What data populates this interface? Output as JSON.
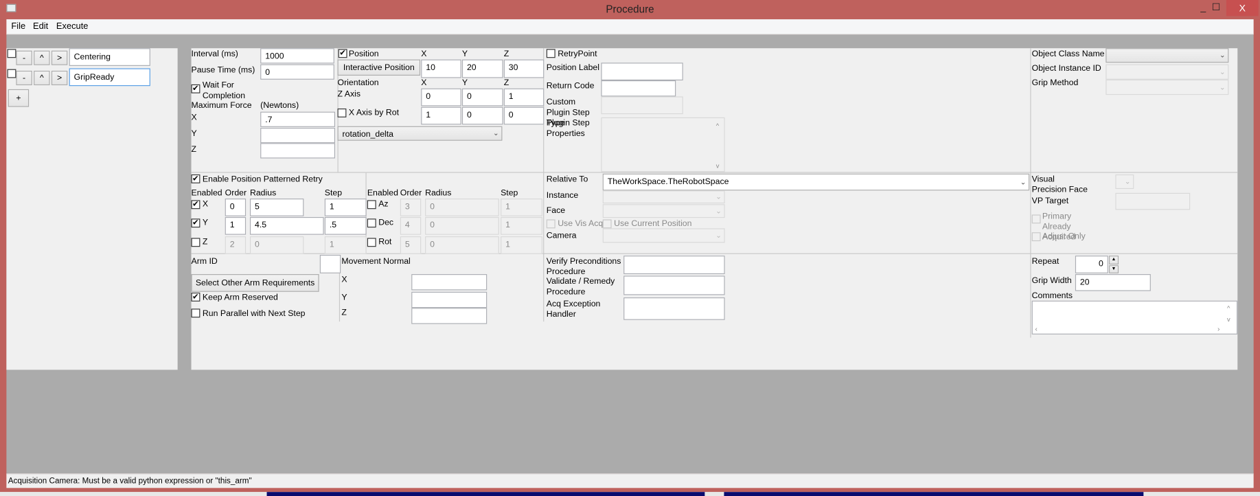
{
  "window": {
    "title": "Procedure",
    "minimize": "_",
    "maximize": "☐",
    "close": "X",
    "close_color": "#c75050",
    "frame_color": "#bf615d"
  },
  "menu": [
    "File",
    "Edit",
    "Execute"
  ],
  "steps": {
    "items": [
      {
        "name": "Centering",
        "checked": false,
        "focused": false
      },
      {
        "name": "GripReady",
        "checked": false,
        "focused": true
      }
    ],
    "remove_label": "-",
    "up_label": "^",
    "down_label": ">",
    "add_label": "+"
  },
  "timing": {
    "interval_label": "Interval (ms)",
    "interval": "1000",
    "pause_label": "Pause Time (ms)",
    "pause": "0",
    "wait_label": "Wait For Completion",
    "wait_checked": true,
    "max_force_label": "Maximum Force",
    "newtons_label": "(Newtons)",
    "x_label": "X",
    "x": ".7",
    "y_label": "Y",
    "y": "",
    "z_label": "Z",
    "z": ""
  },
  "position": {
    "label": "Position",
    "checked": true,
    "x_label": "X",
    "y_label": "Y",
    "z_label": "Z",
    "interactive_button": "Interactive Position",
    "x": "10",
    "y": "20",
    "z": "30",
    "orientation_label": "Orientation",
    "z_axis_label": "Z Axis",
    "z_axis": [
      "0",
      "0",
      "1"
    ],
    "x_axis_by_rot_label": "X Axis by Rot",
    "x_axis_by_rot_checked": false,
    "x_axis": [
      "1",
      "0",
      "0"
    ],
    "rotation_mode": "rotation_delta"
  },
  "retry": {
    "retry_point_label": "RetryPoint",
    "retry_point_checked": false,
    "position_label_label": "Position Label",
    "position_label": "",
    "return_code_label": "Return Code",
    "return_code": "",
    "custom_plugin_label": "Custom Plugin Step Type",
    "plugin_props_label": "Plugin Step Properties"
  },
  "object": {
    "class_name_label": "Object Class Name",
    "class_name": "",
    "instance_id_label": "Object Instance ID",
    "grip_method_label": "Grip Method"
  },
  "patterned_retry": {
    "enable_label": "Enable Position Patterned Retry",
    "enable_checked": true,
    "headers": [
      "Enabled",
      "Order",
      "Radius",
      "Step"
    ],
    "rows": [
      {
        "axis": "X",
        "checked": true,
        "order": "0",
        "radius": "5",
        "step": "1",
        "enabled": true
      },
      {
        "axis": "Y",
        "checked": true,
        "order": "1",
        "radius": "4.5",
        "step": ".5",
        "enabled": true
      },
      {
        "axis": "Z",
        "checked": false,
        "order": "2",
        "radius": "0",
        "step": "1",
        "enabled": false
      },
      {
        "axis": "Az",
        "checked": false,
        "order": "3",
        "radius": "0",
        "step": "1",
        "enabled": false
      },
      {
        "axis": "Dec",
        "checked": false,
        "order": "4",
        "radius": "0",
        "step": "1",
        "enabled": false
      },
      {
        "axis": "Rot",
        "checked": false,
        "order": "5",
        "radius": "0",
        "step": "1",
        "enabled": false
      }
    ]
  },
  "relative": {
    "relative_to_label": "Relative To",
    "relative_to": "TheWorkSpace.TheRobotSpace",
    "instance_label": "Instance",
    "face_label": "Face",
    "use_vis_acq_label": "Use Vis Acq",
    "use_current_position_label": "Use Current Position",
    "camera_label": "Camera"
  },
  "visual": {
    "precision_face_label": "Visual Precision Face",
    "vp_target_label": "VP Target",
    "primary_acquired_label": "Primary Already Acquired",
    "adjust_only_label": "Adjust Only"
  },
  "arm": {
    "arm_id_label": "Arm ID",
    "arm_id": "",
    "select_other_button": "Select Other Arm Requirements",
    "keep_reserved_label": "Keep Arm Reserved",
    "keep_reserved_checked": true,
    "run_parallel_label": "Run Parallel with Next Step",
    "run_parallel_checked": false,
    "movement_normal_label": "Movement Normal",
    "x_label": "X",
    "y_label": "Y",
    "z_label": "Z"
  },
  "procedures": {
    "verify_label": "Verify Preconditions Procedure",
    "validate_label": "Validate / Remedy Procedure",
    "acq_exception_label": "Acq Exception Handler"
  },
  "misc": {
    "repeat_label": "Repeat",
    "repeat": "0",
    "grip_width_label": "Grip Width",
    "grip_width": "20",
    "comments_label": "Comments",
    "comments": ""
  },
  "status": "Acquisition Camera: Must be a valid python expression or \"this_arm\""
}
